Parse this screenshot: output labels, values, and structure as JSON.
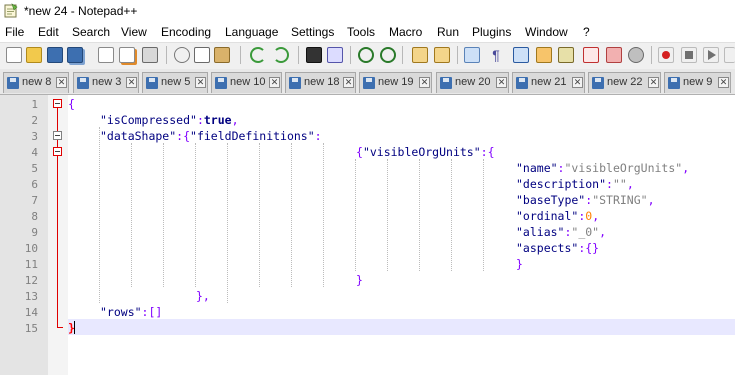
{
  "window": {
    "title": "*new 24 - Notepad++"
  },
  "menu": [
    "File",
    "Edit",
    "Search",
    "View",
    "Encoding",
    "Language",
    "Settings",
    "Tools",
    "Macro",
    "Run",
    "Plugins",
    "Window",
    "?"
  ],
  "toolbar": {
    "icons": [
      "new-file-icon",
      "open-file-icon",
      "save-icon",
      "save-all-icon",
      "close-icon",
      "close-all-icon",
      "print-icon",
      "cut-icon",
      "copy-icon",
      "paste-icon",
      "undo-icon",
      "redo-icon",
      "find-icon",
      "replace-icon",
      "zoom-in-icon",
      "zoom-out-icon",
      "sync-vertical-icon",
      "sync-horizontal-icon",
      "word-wrap-icon",
      "all-characters-icon",
      "indent-guide-icon",
      "document-map-icon",
      "function-list-icon",
      "folder-as-workspace-icon",
      "monitoring-icon",
      "record-macro-icon",
      "stop-recording-icon",
      "playback-icon",
      "run-macro-icon"
    ]
  },
  "tabs": [
    {
      "label": "new 8"
    },
    {
      "label": "new 3"
    },
    {
      "label": "new 5"
    },
    {
      "label": "new 10"
    },
    {
      "label": "new 18"
    },
    {
      "label": "new 19"
    },
    {
      "label": "new 20"
    },
    {
      "label": "new 21"
    },
    {
      "label": "new 22"
    },
    {
      "label": "new 9"
    }
  ],
  "editor": {
    "line_numbers": [
      "1",
      "2",
      "3",
      "4",
      "5",
      "6",
      "7",
      "8",
      "9",
      "10",
      "11",
      "12",
      "13",
      "14",
      "15"
    ],
    "lines": [
      [
        [
          "brace",
          "{"
        ]
      ],
      [
        [
          "key",
          "\"isCompressed\""
        ],
        [
          "op",
          ":"
        ],
        [
          "kw",
          "true"
        ],
        [
          "op",
          ","
        ]
      ],
      [
        [
          "key",
          "\"dataShape\""
        ],
        [
          "op",
          ":{"
        ],
        [
          "key",
          "\"fieldDefinitions\""
        ],
        [
          "op",
          ":"
        ]
      ],
      [
        [
          "op",
          "{"
        ],
        [
          "key",
          "\"visibleOrgUnits\""
        ],
        [
          "op",
          ":{"
        ]
      ],
      [
        [
          "key",
          "\"name\""
        ],
        [
          "op",
          ":"
        ],
        [
          "str",
          "\"visibleOrgUnits\""
        ],
        [
          "op",
          ","
        ]
      ],
      [
        [
          "key",
          "\"description\""
        ],
        [
          "op",
          ":"
        ],
        [
          "str",
          "\"\""
        ],
        [
          "op",
          ","
        ]
      ],
      [
        [
          "key",
          "\"baseType\""
        ],
        [
          "op",
          ":"
        ],
        [
          "str",
          "\"STRING\""
        ],
        [
          "op",
          ","
        ]
      ],
      [
        [
          "key",
          "\"ordinal\""
        ],
        [
          "op",
          ":"
        ],
        [
          "num",
          "0"
        ],
        [
          "op",
          ","
        ]
      ],
      [
        [
          "key",
          "\"alias\""
        ],
        [
          "op",
          ":"
        ],
        [
          "str",
          "\"_0\""
        ],
        [
          "op",
          ","
        ]
      ],
      [
        [
          "key",
          "\"aspects\""
        ],
        [
          "op",
          ":{}"
        ]
      ],
      [
        [
          "op",
          "}"
        ]
      ],
      [
        [
          "op",
          "}"
        ]
      ],
      [
        [
          "op",
          "},"
        ]
      ],
      [
        [
          "key",
          "\"rows\""
        ],
        [
          "op",
          ":[]"
        ]
      ],
      [
        [
          "hl",
          "}"
        ]
      ]
    ]
  },
  "colors": {
    "key": "#000080",
    "string": "#808080",
    "operator": "#8000ff",
    "number": "#ff8000",
    "brace_highlight": "#ff0000",
    "fold_margin": "#e00000",
    "current_line": "#e8e8ff"
  }
}
